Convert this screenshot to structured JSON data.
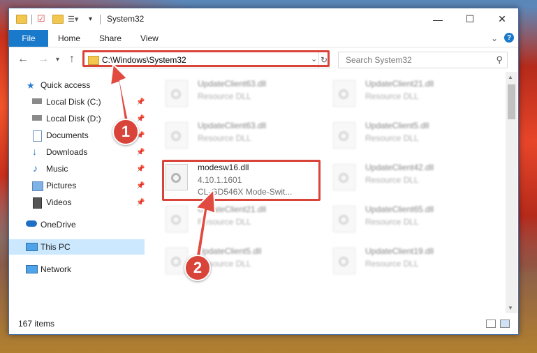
{
  "window": {
    "title": "System32",
    "controls": {
      "minimize": "—",
      "maximize": "☐",
      "close": "✕"
    }
  },
  "ribbon": {
    "tabs": [
      "File",
      "Home",
      "Share",
      "View"
    ],
    "expand": "⌄",
    "help": "?"
  },
  "address": {
    "path": "C:\\Windows\\System32",
    "dropdown": "⌄",
    "refresh": "↻"
  },
  "search": {
    "placeholder": "Search System32"
  },
  "nav": {
    "items": [
      {
        "label": "Quick access",
        "icon": "star-icon"
      },
      {
        "label": "Local Disk (C:)",
        "icon": "drive-icon",
        "pinned": true
      },
      {
        "label": "Local Disk (D:)",
        "icon": "drive-icon",
        "pinned": true
      },
      {
        "label": "Documents",
        "icon": "documents-icon",
        "pinned": true
      },
      {
        "label": "Downloads",
        "icon": "download-icon",
        "pinned": true
      },
      {
        "label": "Music",
        "icon": "music-icon",
        "pinned": true
      },
      {
        "label": "Pictures",
        "icon": "pictures-icon",
        "pinned": true
      },
      {
        "label": "Videos",
        "icon": "videos-icon",
        "pinned": true
      },
      {
        "label": "OneDrive",
        "icon": "cloud-icon"
      },
      {
        "label": "This PC",
        "icon": "computer-icon",
        "selected": true
      },
      {
        "label": "Network",
        "icon": "network-icon"
      }
    ]
  },
  "files": [
    {
      "name": "UpdateClient63.dll",
      "type": "Resource DLL"
    },
    {
      "name": "UpdateClient21.dll",
      "type": "Resource DLL"
    },
    {
      "name": "UpdateClient63.dll",
      "type": "Resource DLL"
    },
    {
      "name": "UpdateClient5.dll",
      "type": "Resource DLL"
    },
    {
      "name": "modesw16.dll",
      "version": "4.10.1.1601",
      "description": "CL-GD546X Mode-Swit..."
    },
    {
      "name": "UpdateClient42.dll",
      "type": "Resource DLL"
    },
    {
      "name": "UpdateClient21.dll",
      "type": "Resource DLL"
    },
    {
      "name": "UpdateClient65.dll",
      "type": "Resource DLL"
    },
    {
      "name": "UpdateClient5.dll",
      "type": "Resource DLL"
    },
    {
      "name": "UpdateClient19.dll",
      "type": "Resource DLL"
    }
  ],
  "status": {
    "item_count": "167 items"
  },
  "callouts": [
    "1",
    "2"
  ],
  "colors": {
    "accent": "#1979ca",
    "highlight": "#d9443a",
    "selected": "#cce8ff"
  }
}
